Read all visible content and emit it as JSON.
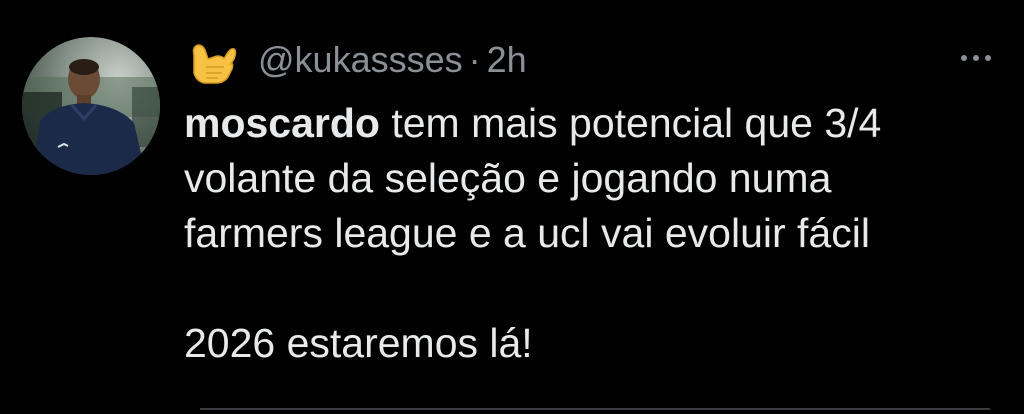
{
  "tweet": {
    "handle": "@kukassses",
    "separator": "·",
    "time": "2h",
    "display_emoji": "call-me-hand-emoji",
    "mention": "moscardo",
    "line1_rest": " tem mais potencial que 3/4",
    "line2": "volante da seleção e jogando numa",
    "line3": "farmers league e a ucl vai evoluir fácil",
    "line4": "2026 estaremos lá!"
  },
  "colors": {
    "background": "#000000",
    "text": "#e7e9ea",
    "muted": "#8b9096"
  }
}
